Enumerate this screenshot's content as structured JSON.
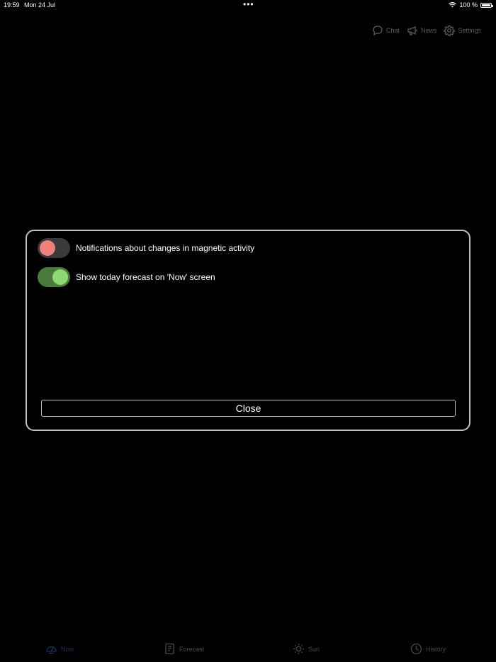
{
  "status_bar": {
    "time": "19:59",
    "date": "Mon 24 Jul",
    "dots": "•••",
    "battery": "100 %"
  },
  "top_nav": {
    "chat": "Chat",
    "news": "News",
    "settings": "Settings"
  },
  "dialog": {
    "settings": [
      {
        "label": "Notifications about changes in magnetic activity",
        "enabled": false
      },
      {
        "label": "Show today forecast on 'Now' screen",
        "enabled": true
      }
    ],
    "close_label": "Close"
  },
  "tabs": {
    "now": "Now",
    "forecast": "Forecast",
    "sun": "Sun",
    "history": "History",
    "active": "now"
  },
  "colors": {
    "toggle_off_knob": "#f08079",
    "toggle_on_track": "#4c7a3a",
    "toggle_on_knob": "#8ed873",
    "dialog_border": "#bfbfbf",
    "active_tab": "#16325e"
  }
}
